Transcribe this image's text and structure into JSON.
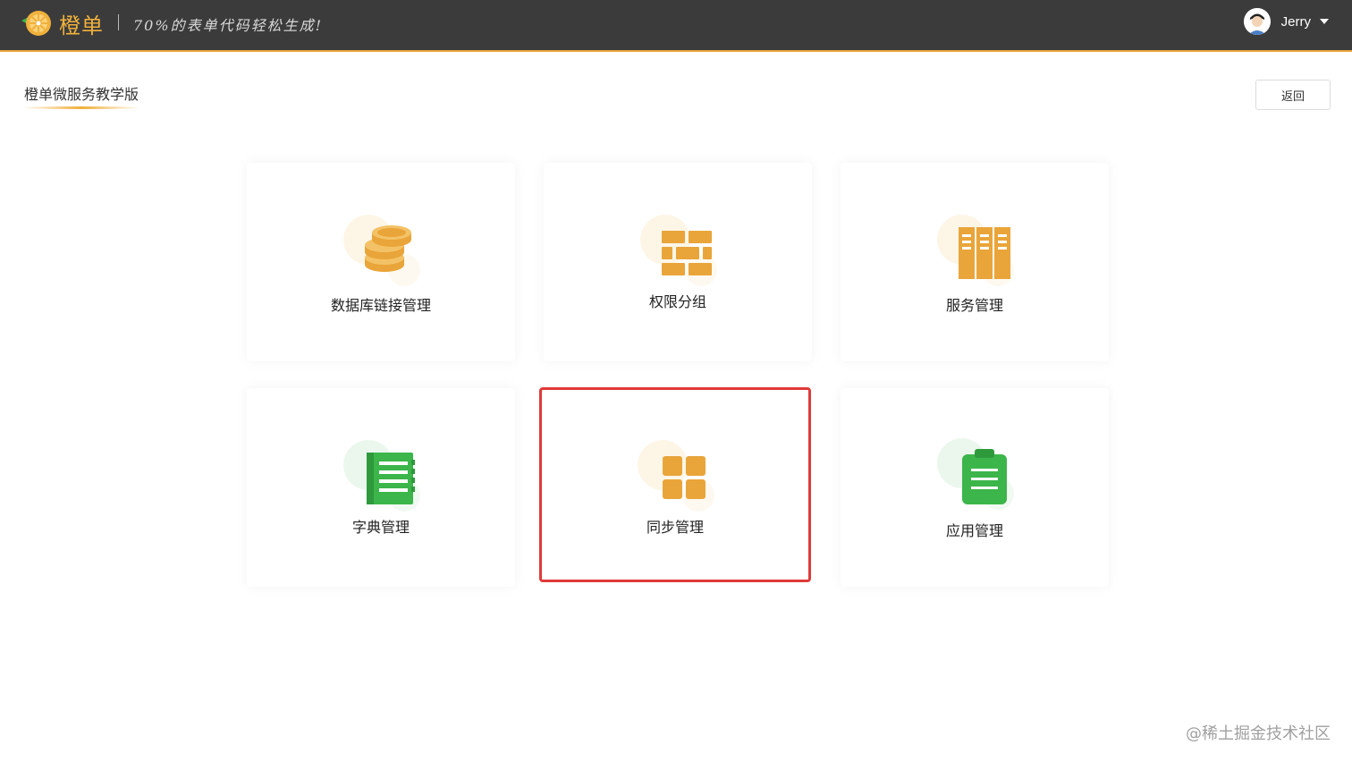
{
  "header": {
    "brand": "橙单",
    "slogan": "70%的表单代码轻松生成!",
    "username": "Jerry"
  },
  "page": {
    "title": "橙单微服务教学版",
    "back_label": "返回"
  },
  "cards": [
    {
      "label": "数据库链接管理",
      "icon": "database-icon",
      "color": "#e9a53a"
    },
    {
      "label": "权限分组",
      "icon": "brick-wall-icon",
      "color": "#e9a53a"
    },
    {
      "label": "服务管理",
      "icon": "books-icon",
      "color": "#e9a53a"
    },
    {
      "label": "字典管理",
      "icon": "book-icon",
      "color": "#3cb54a"
    },
    {
      "label": "同步管理",
      "icon": "grid-icon",
      "color": "#e9a53a",
      "selected": true
    },
    {
      "label": "应用管理",
      "icon": "clipboard-icon",
      "color": "#3cb54a"
    }
  ],
  "colors": {
    "accent": "#f0b13c",
    "orange_icon": "#e9a53a",
    "green_icon": "#3cb54a",
    "selection_border": "#e03a3a",
    "topbar": "#3b3b3b"
  },
  "watermark": "@稀土掘金技术社区"
}
